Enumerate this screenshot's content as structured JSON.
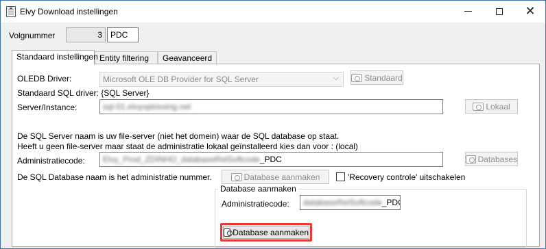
{
  "window": {
    "title": "Elvy Download instellingen"
  },
  "header": {
    "volgnummer_label": "Volgnummer",
    "volgnummer_value": "3",
    "code_value": "PDC"
  },
  "tabs": [
    {
      "label": "Standaard instellingen",
      "active": true
    },
    {
      "label": "Entity filtering",
      "active": false
    },
    {
      "label": "Geavanceerd",
      "active": false
    }
  ],
  "form": {
    "oledb_label": "OLEDB Driver:",
    "oledb_value": "Microsoft OLE DB Provider for SQL Server",
    "standaard_button": "Standaard",
    "sql_driver_text": "Standaard SQL driver: {SQL Server}",
    "server_label": "Server/Instance:",
    "server_value": "sql-01.elvyoplossing.net",
    "lokaal_button": "Lokaal",
    "info_line1": "De SQL Server naam is uw  file-server (niet het domein) waar de SQL database op staat.",
    "info_line2": "Heeft u geen file-server maar staat de administratie lokaal geïnstalleerd kies dan voor : (local)",
    "admincode_label": "Administratiecode:",
    "admincode_blurred": "Elvy_Prod_ZDINHO_databaseRelSoftcode",
    "admincode_suffix": "_PDC",
    "databases_button": "Databases",
    "db_name_text": "De SQL Database naam is het administratie nummer.",
    "db_create_button": "Database aanmaken",
    "recovery_label": "'Recovery controle' uitschakelen"
  },
  "create_group": {
    "title": "Database aanmaken",
    "admincode_label": "Administratiecode:",
    "admincode_blurred": "databaseRelSoftcode",
    "admincode_suffix": "_PDC",
    "create_button": "Database aanmaken"
  },
  "colors": {
    "highlight": "#e53935",
    "titlebar_bg": "#ffffff",
    "window_border": "#3c6fb0"
  }
}
